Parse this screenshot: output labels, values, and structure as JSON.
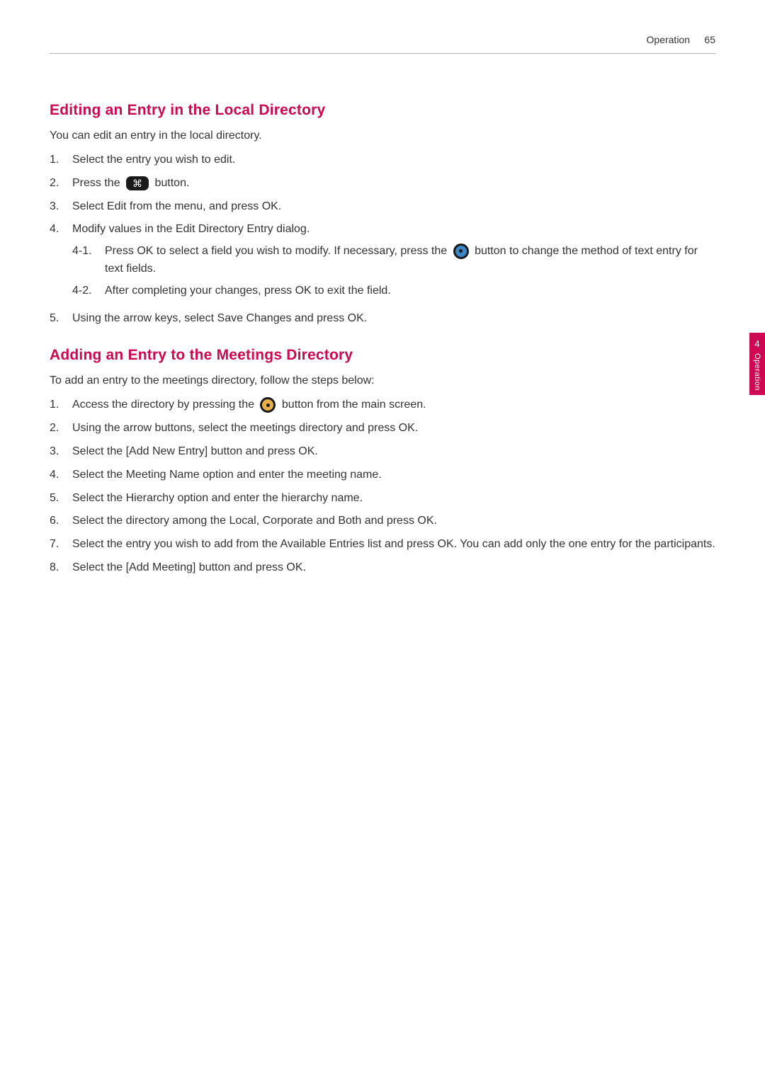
{
  "header": {
    "section": "Operation",
    "page_number": "65"
  },
  "side_tab": {
    "chapter": "4",
    "label": "Operation"
  },
  "sec1": {
    "heading": "Editing an Entry in the Local Directory",
    "intro": "You can edit an entry in the local directory.",
    "steps": {
      "s1": "Select the entry you wish to edit.",
      "s2_a": "Press the ",
      "s2_b": " button.",
      "s3": "Select Edit from the menu, and press OK.",
      "s4": "Modify values in the Edit Directory Entry dialog.",
      "s4_1_label": "4-1.",
      "s4_1_a": "Press OK to select a field you wish to modify. If necessary, press the ",
      "s4_1_b": " button to change the method of text entry for text fields.",
      "s4_2_label": "4-2.",
      "s4_2": "After completing your changes, press OK to exit the field.",
      "s5": "Using the arrow keys, select Save Changes and press OK."
    }
  },
  "sec2": {
    "heading": "Adding an Entry to the Meetings Directory",
    "intro": "To add an entry to the meetings directory, follow the steps below:",
    "steps": {
      "s1_a": "Access the directory by pressing the ",
      "s1_b": " button from the main screen.",
      "s2": "Using the arrow buttons, select the meetings directory and press OK.",
      "s3": "Select the [Add New Entry] button and press OK.",
      "s4": "Select the Meeting Name option and enter the meeting name.",
      "s5": "Select the Hierarchy option and enter the hierarchy name.",
      "s6": "Select the directory among the Local, Corporate and Both and press OK.",
      "s7": "Select the entry you wish to add from the Available Entries list and press OK. You can add only the one entry for the participants.",
      "s8": "Select the [Add Meeting] button and press OK."
    }
  },
  "icons": {
    "menu_glyph": "⌘"
  }
}
